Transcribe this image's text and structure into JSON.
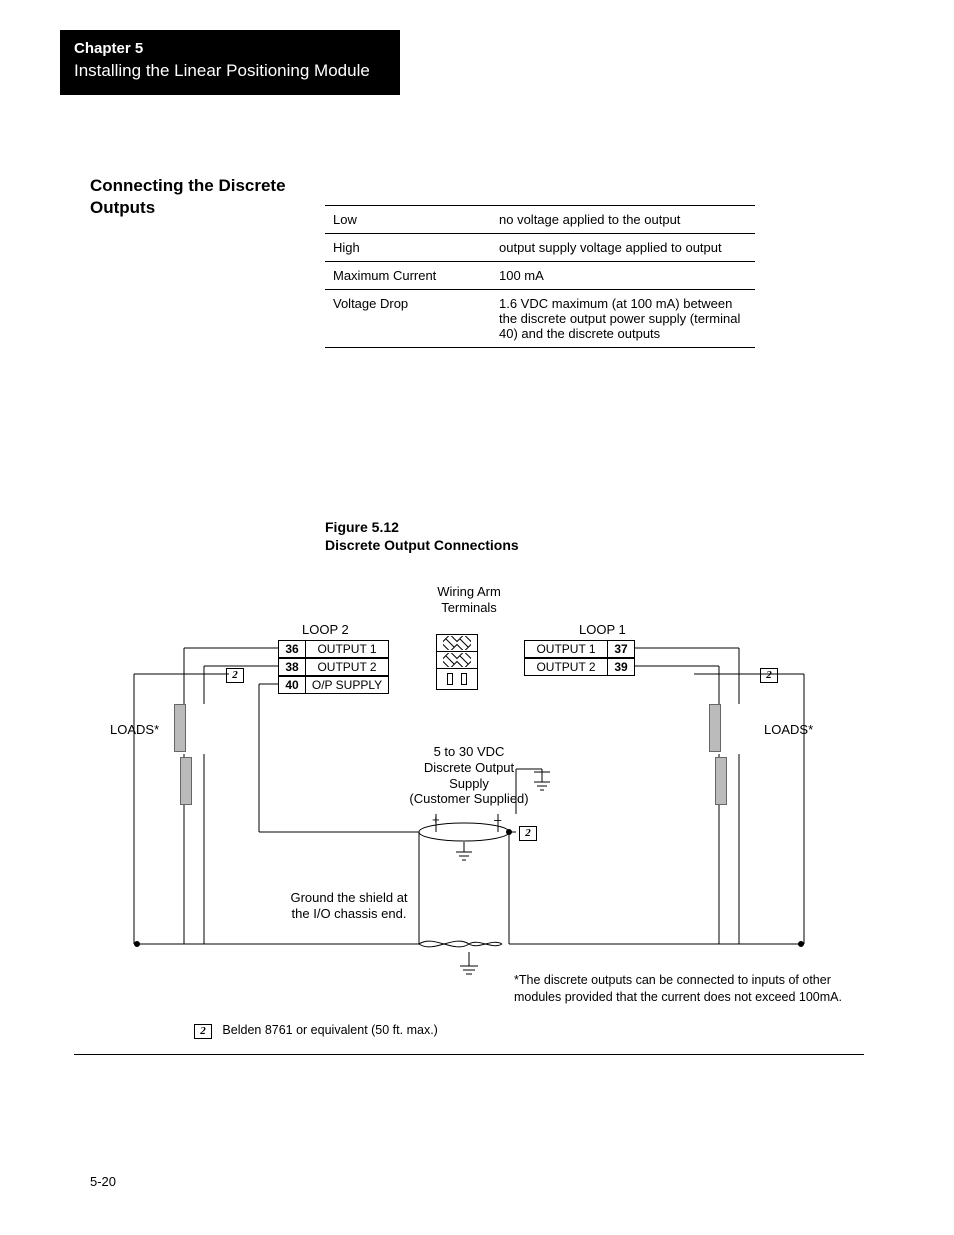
{
  "chapter": {
    "number_label": "Chapter 5",
    "title": "Installing the Linear Positioning Module"
  },
  "section_heading": "Connecting the Discrete Outputs",
  "spec_table": [
    {
      "key": "Low",
      "value": "no voltage applied to the output"
    },
    {
      "key": "High",
      "value": "output supply voltage applied to output"
    },
    {
      "key": "Maximum Current",
      "value": "100 mA"
    },
    {
      "key": "Voltage Drop",
      "value": "1.6 VDC maximum (at 100 mA) between the discrete output power supply (terminal 40) and the discrete outputs"
    }
  ],
  "figure": {
    "number": "Figure 5.12",
    "title": "Discrete Output Connections"
  },
  "diagram": {
    "wiring_arm_label": "Wiring Arm\nTerminals",
    "loop2_label": "LOOP 2",
    "loop1_label": "LOOP 1",
    "left_pins": [
      {
        "num": "36",
        "label": "OUTPUT 1"
      },
      {
        "num": "38",
        "label": "OUTPUT 2"
      },
      {
        "num": "40",
        "label": "O/P SUPPLY"
      }
    ],
    "right_pins": [
      {
        "label": "OUTPUT 1",
        "num": "37"
      },
      {
        "label": "OUTPUT 2",
        "num": "39"
      }
    ],
    "loads_label": "LOADS*",
    "cable_marker": "2",
    "supply_label": "5 to 30 VDC\nDiscrete Output\nSupply\n(Customer Supplied)",
    "plus": "+",
    "minus": "–",
    "ground_note": "Ground the shield at\nthe I/O chassis end.",
    "asterisk_note": "*The discrete outputs can be connected to inputs of other modules provided that the current does not exceed 100mA.",
    "legend_note": "Belden 8761 or equivalent (50 ft. max.)"
  },
  "page_number": "5-20"
}
